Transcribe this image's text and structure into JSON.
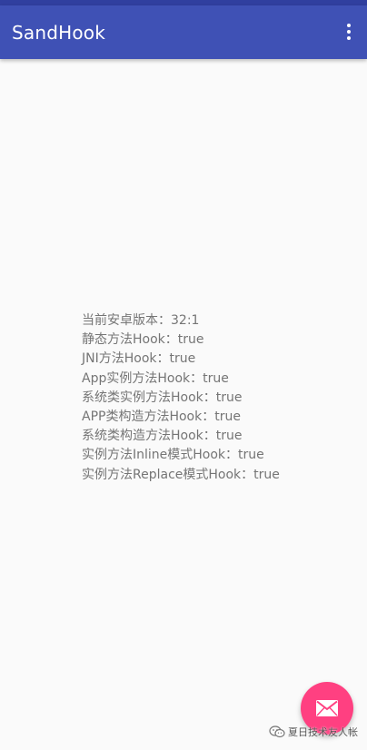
{
  "app_bar": {
    "title": "SandHook",
    "menu_icon": "more-vert-icon",
    "color": "#3f51b5",
    "status_bar_color": "#303f9f"
  },
  "results": [
    "当前安卓版本：32:1",
    "静态方法Hook：true",
    "JNI方法Hook：true",
    "App实例方法Hook：true",
    "系统类实例方法Hook：true",
    "APP类构造方法Hook：true",
    "系统类构造方法Hook：true",
    "实例方法Inline模式Hook：true",
    "实例方法Replace模式Hook：true"
  ],
  "fab": {
    "icon": "mail-icon",
    "color": "#ff4081"
  },
  "watermark": {
    "icon": "wechat-icon",
    "text": "夏日技术友人帐"
  }
}
